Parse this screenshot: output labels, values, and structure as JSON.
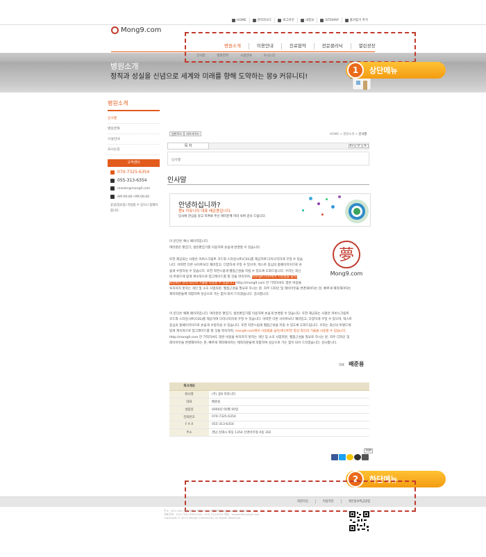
{
  "util": [
    {
      "label": "HOME",
      "icon": "home-icon"
    },
    {
      "label": "관리자모드",
      "icon": "gear-icon"
    },
    {
      "label": "로그아웃",
      "icon": "lock-icon"
    },
    {
      "label": "내정보",
      "icon": "user-icon"
    },
    {
      "label": "SITEMAP",
      "icon": "sitemap-icon"
    },
    {
      "label": "즐겨찾기 추가",
      "icon": "star-icon"
    }
  ],
  "logo": "Mong9.com",
  "gnb": [
    "병원소개",
    "이용안내",
    "진료협약",
    "전문클리닉",
    "열린광장"
  ],
  "sub": [
    "인사말",
    "병원연혁",
    "시설안내",
    "오시는길"
  ],
  "banner": {
    "title": "병원소개",
    "slogan": "정직과 성실을 신념으로 세계와 미래를 향해 도약하는 몽9 커뮤니티!"
  },
  "callouts": {
    "top": {
      "num": "1",
      "label": "상단메뉴"
    },
    "bottom": {
      "num": "2",
      "label": "하단메뉴"
    }
  },
  "lnb": {
    "title": "병원소개",
    "items": [
      "인사말",
      "병원연혁",
      "시설안내",
      "오시는길"
    ]
  },
  "cs": {
    "title": "고객센터",
    "tel1": "070-7325-6354",
    "tel2": "055-313-6354",
    "mail": "master@mong9.com",
    "hours": "AM 09:00~PM 06:00",
    "note": "휴일(일요일) 지정될 수 있으니 참해야 합니다."
  },
  "content": {
    "btn_print": "일반모드",
    "btn_admin": "서브가이드",
    "location": [
      "HOME",
      "병원소개",
      "인사말"
    ],
    "toc_tab": "목 차",
    "toc_item": "인사말",
    "font_ctl": [
      "A+",
      "0",
      "A-"
    ],
    "page_title": "인사말"
  },
  "greet": {
    "h1": "안녕하십니까?",
    "h2": "몽9 커뮤니티 대표 배준용입니다.",
    "h3": "당사에 관심을 갖고 지켜봐 주신 여러분께 머리 숙여 감사 드립니다."
  },
  "para1": [
    "이 문단은 예시 페이지입니다.",
    "여러분은 편집기, 생은편집기를 이용하여 손쉽게 변경할 수 있습니다."
  ],
  "para2": {
    "l1": "또한 제공되는 사항은 커버스크립트 코드와 스타일시트(CSS)를 제공하여 다이나믹하게 꾸밀 수 있습",
    "l2": "니다. 어떠한 다른 사이트보다 재미있고, 다양하게 꾸밀 수 있으며, 텍스트 중심의 홈페이지이므로 손",
    "l3": "쉽게 수정하실 수 있습니다. 또한 자연스럽게 웹접근성을 지킬 수 있도록 도와드립니다. 우리는 최신",
    "l4a": "의 트렌드에 맞게 계속적으로 업그레이드를 할 것을 약속하며,",
    "l4hl": "mong9.com에서 사용법을 습득/",
    "l5hl": "최신버전 관리 최신의 기술을 사용할 수 있습니다.",
    "l5b": "http://mong9.com 만 기억하셔도 많은 비용을",
    "l6": "투자하지 못하는 개인 및 소호 사업자분, 웹접근성을 필요로 하시는 분, 자주 디자인 및 레이아웃을 변경해야하는 분, 빠르게 제작해야하는",
    "l7": "제작자분들께 적합하여 성공으로 가는 힘이 되어 드리겠습니다. 감사합니다."
  },
  "para3": {
    "l1": "이 문단은 예제 페이지입니다. 여러분은 편집기, 생은편집기를 이용하여 손쉽게 변경할 수 있습니다. 또한 제공되는 사항은 커버스크립트",
    "l2": "코드와 스타일시트(CSS)를 제공하여 다이나믹하게 꾸밀 수 있습니다. 어떠한 다른 사이트보다 재미있고, 다양하게 꾸밀 수 있으며, 텍스트",
    "l3": "중심의 홈페이지이므로 손쉽게 수정하실 수 있습니다. 또한 자연스럽게 웹접근성을 지킬 수 있도록 도와드립니다. 우리는 최신의 트렌드에",
    "l4": "맞게 계속적으로 업그레이드를 할 것을 약속하며,",
    "l4o": "mong9.com에서 사용법을 습득/최신버전 항상 최신의 기술을 사용할 수 있습니다.",
    "l5": "http://mong9.com 만 기억하셔도 많은 비용을 투자하지 못하는 개인 및 소호 사업자분, 웹접근성을 필요로 하시는 분, 자주 디자인 및",
    "l6": "레이아웃을 변경해야하는 분, 빠르게 제작해야하는 제작자분들께 적합하여 성공으로 가는 힘이 되어 드리겠습니다. 감사합니다."
  },
  "seal": {
    "char": "夢",
    "label": "Mong9.com"
  },
  "sign": {
    "role": "대표",
    "name": "배준용"
  },
  "company": {
    "title": "회사개요",
    "rows": [
      {
        "k": "회사명",
        "v": "(주) 몽9 커뮤니티"
      },
      {
        "k": "대표",
        "v": "배준용"
      },
      {
        "k": "설립일",
        "v": "0000년 00월 00일"
      },
      {
        "k": "전화번호",
        "v": "070-7325-6354"
      },
      {
        "k": "F A X",
        "v": "055-313-6354"
      },
      {
        "k": "주소",
        "v": "경남 김해시 외동 1354 신명아트빌 A동 302"
      }
    ]
  },
  "top_btn": "TOP",
  "footer": {
    "links": [
      "회원가입",
      "이용약관",
      "개인정보취급방침"
    ],
    "addr1": "주소 : 621-090 경남 김해시 외동 1354 신명아트빌 A동 302 몽9 커뮤니티",
    "addr2": "대표전화 : 070-7325-6354   FAX : 055-313-6354   메일 : master@mong9.com",
    "copy": "Copyright © 2014 Mong9 Community. All Rights Reserved."
  },
  "colors": {
    "accent": "#e25a1c",
    "callout": "#f39c12",
    "dash": "#c0392b"
  }
}
